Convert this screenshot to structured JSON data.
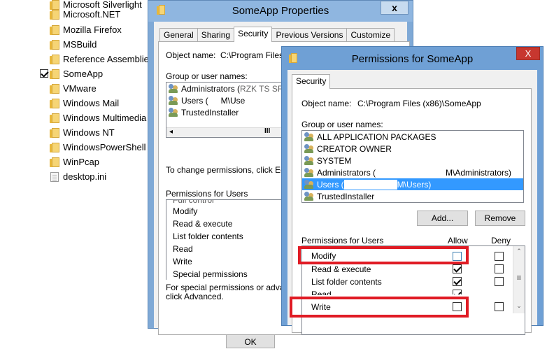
{
  "tree": {
    "items": [
      {
        "label": "Microsoft Silverlight",
        "type": "folder"
      },
      {
        "label": "Microsoft.NET",
        "type": "folder"
      },
      {
        "label": "Mozilla Firefox",
        "type": "folder"
      },
      {
        "label": "MSBuild",
        "type": "folder"
      },
      {
        "label": "Reference Assemblies",
        "type": "folder"
      },
      {
        "label": "SomeApp",
        "type": "folder",
        "checked": true
      },
      {
        "label": "VMware",
        "type": "folder"
      },
      {
        "label": "Windows Mail",
        "type": "folder"
      },
      {
        "label": "Windows Multimedia Platform",
        "type": "folder"
      },
      {
        "label": "Windows NT",
        "type": "folder"
      },
      {
        "label": "WindowsPowerShell",
        "type": "folder"
      },
      {
        "label": "WinPcap",
        "type": "folder"
      },
      {
        "label": "desktop.ini",
        "type": "file"
      }
    ]
  },
  "props": {
    "title": "SomeApp Properties",
    "close": "x",
    "tabs": [
      "General",
      "Sharing",
      "Security",
      "Previous Versions",
      "Customize"
    ],
    "object_name_label": "Object name:",
    "object_name_value": "C:\\Program Files",
    "group_label": "Group or user names:",
    "groups": [
      "Administrators (",
      "Users (",
      "TrustedInstaller"
    ],
    "groups_partial": [
      "RZK TS SRV\\",
      "M\\Use"
    ],
    "change_text": "To change permissions, click Edit.",
    "perms_label": "Permissions for Users",
    "perms": [
      "Full control",
      "Modify",
      "Read & execute",
      "List folder contents",
      "Read",
      "Write",
      "Special permissions"
    ],
    "special_text_1": "For special permissions or advance",
    "special_text_2": "click Advanced.",
    "ok_partial": "OK"
  },
  "perm": {
    "title": "Permissions for SomeApp",
    "close": "X",
    "tab": "Security",
    "object_name_label": "Object name:",
    "object_name_value": "C:\\Program Files (x86)\\SomeApp",
    "group_label": "Group or user names:",
    "groups": [
      {
        "name": "ALL APPLICATION PACKAGES"
      },
      {
        "name": "CREATOR OWNER"
      },
      {
        "name": "SYSTEM"
      },
      {
        "name": "Administrators (",
        "suffix": "M\\Administrators)"
      },
      {
        "name": "Users (",
        "suffix": "M\\Users)",
        "selected": true
      },
      {
        "name": "TrustedInstaller"
      }
    ],
    "add_button": "Add...",
    "remove_button": "Remove",
    "perms_label": "Permissions for Users",
    "allow_label": "Allow",
    "deny_label": "Deny",
    "perms": [
      {
        "name": "Modify",
        "allow": false,
        "deny": false
      },
      {
        "name": "Read & execute",
        "allow": true,
        "deny": false
      },
      {
        "name": "List folder contents",
        "allow": true,
        "deny": false
      },
      {
        "name": "Read",
        "allow": true,
        "deny": false
      },
      {
        "name": "Write",
        "allow": false,
        "deny": false
      }
    ]
  },
  "colors": {
    "selection": "#3399ff",
    "highlight_box": "#e01b24",
    "props_frame": "#8fb6e0",
    "perm_frame": "#6fa0d5"
  }
}
